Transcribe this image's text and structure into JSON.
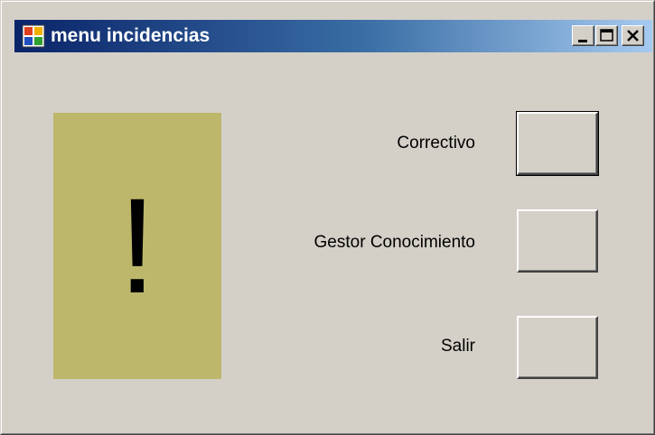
{
  "window": {
    "title": "menu incidencias",
    "title_bar_color": "#0a246a",
    "background_color": "#d4d0c8"
  },
  "icons": {
    "app": "app-window-icon",
    "minimize": "minimize-icon",
    "maximize": "maximize-icon",
    "close": "close-icon"
  },
  "warning": {
    "glyph": "!",
    "panel_color": "#bdb76b"
  },
  "menu": {
    "correctivo_label": "Correctivo",
    "gestor_label": "Gestor Conocimiento",
    "salir_label": "Salir"
  }
}
